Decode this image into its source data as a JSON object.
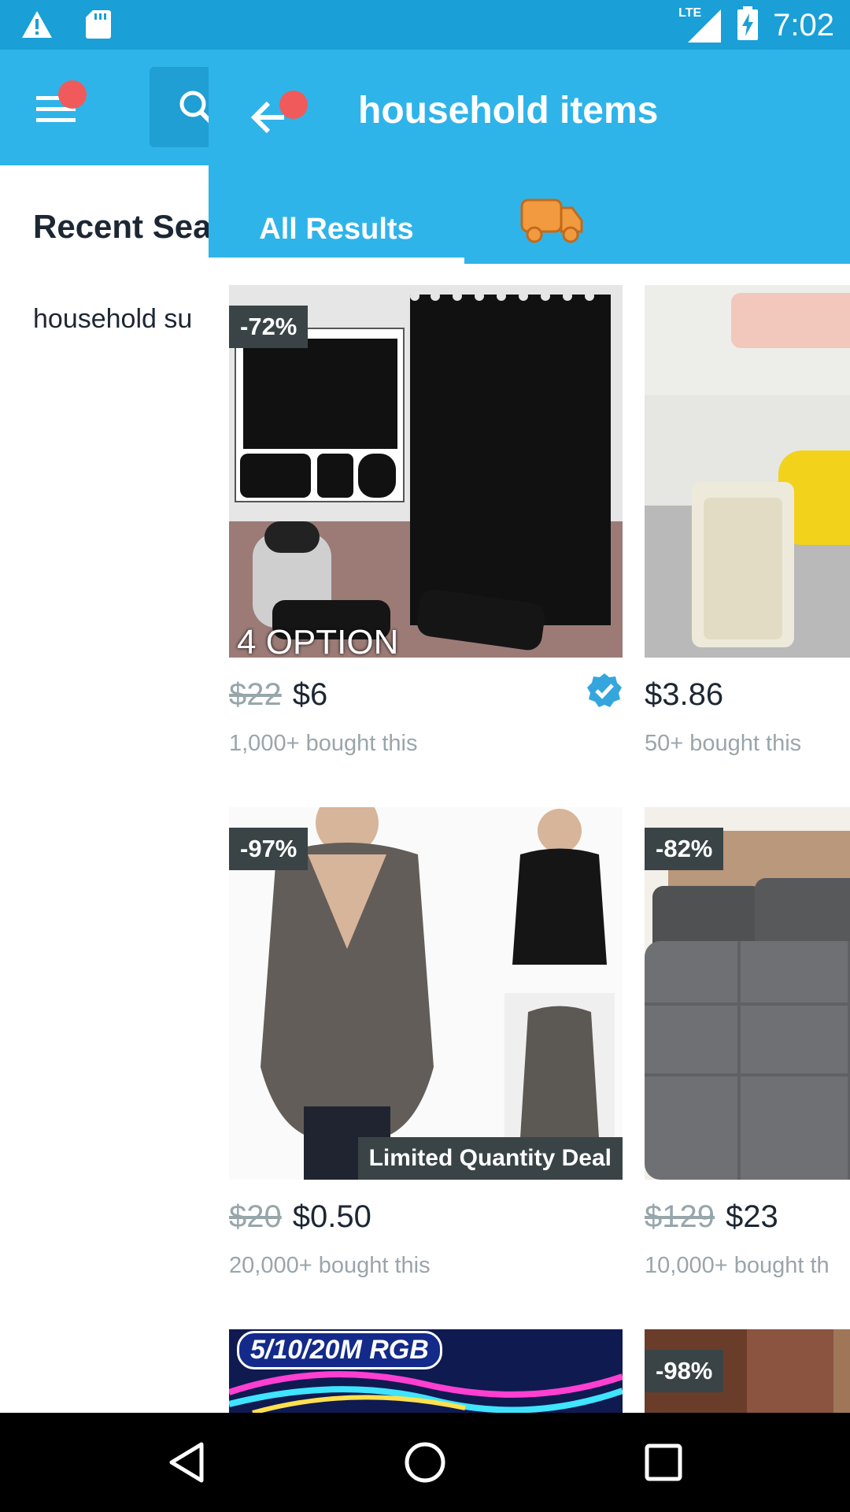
{
  "status_bar": {
    "time": "7:02",
    "network": "LTE",
    "icons": [
      "warning-icon",
      "sd-card-icon",
      "signal-icon",
      "battery-charging-icon"
    ]
  },
  "background_page": {
    "recent_title": "Recent Sea",
    "recent_item": "household su",
    "icons": [
      "menu-icon",
      "search-icon"
    ]
  },
  "overlay": {
    "title": "household items",
    "tabs": [
      {
        "label": "All Results"
      }
    ],
    "accent_color": "#2fb4e9",
    "icons": [
      "back-arrow-icon",
      "truck-icon"
    ]
  },
  "products": [
    {
      "badge": "-72%",
      "image_text": "4 OPTION",
      "old_price": "$22",
      "price": "$6",
      "bought": "1,000+ bought this",
      "verified": true
    },
    {
      "badge": "",
      "old_price": "",
      "price": "$3.86",
      "bought": "50+ bought this"
    },
    {
      "badge": "-97%",
      "deal": "Limited Quantity Deal",
      "old_price": "$20",
      "price": "$0.50",
      "bought": "20,000+ bought this"
    },
    {
      "badge": "-82%",
      "old_price": "$129",
      "price": "$23",
      "bought": "10,000+ bought th"
    },
    {
      "badge": "",
      "image_text": "5/10/20M RGB"
    },
    {
      "badge": "-98%"
    }
  ],
  "nav_bar": {
    "icons": [
      "back-triangle-icon",
      "home-circle-icon",
      "recents-square-icon"
    ]
  }
}
